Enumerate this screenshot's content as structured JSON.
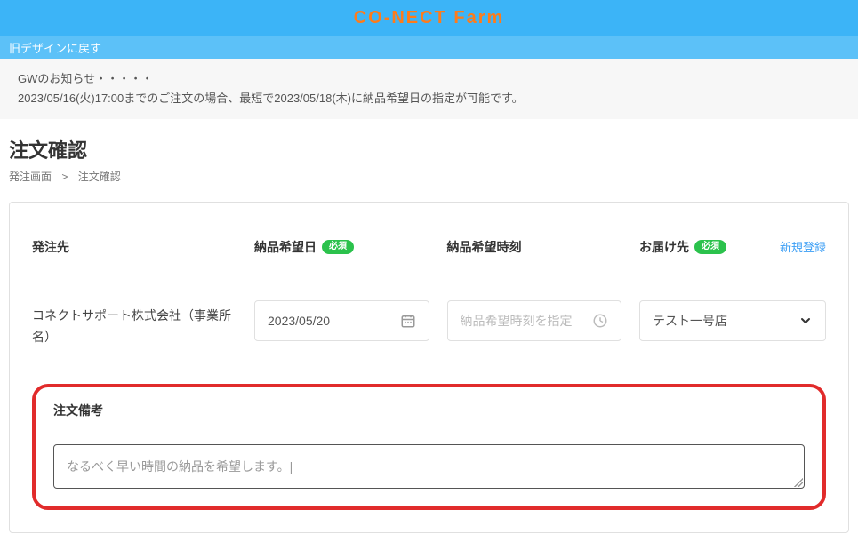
{
  "header": {
    "title": "CO-NECT Farm",
    "back_link": "旧デザインに戻す"
  },
  "notice": {
    "line1": "GWのお知らせ・・・・・",
    "line2": "2023/05/16(火)17:00までのご注文の場合、最短で2023/05/18(木)に納品希望日の指定が可能です。"
  },
  "page": {
    "title": "注文確認",
    "breadcrumb_prev": "発注画面",
    "breadcrumb_sep": ">",
    "breadcrumb_current": "注文確認"
  },
  "labels": {
    "destination": "発注先",
    "delivery_date": "納品希望日",
    "delivery_time": "納品希望時刻",
    "ship_to": "お届け先",
    "required": "必須",
    "new_register": "新規登録",
    "remarks": "注文備考"
  },
  "values": {
    "destination": "コネクトサポート株式会社（事業所名）",
    "delivery_date": "2023/05/20",
    "delivery_time_placeholder": "納品希望時刻を指定",
    "ship_to": "テスト一号店",
    "remarks": "なるべく早い時間の納品を希望します。|"
  }
}
